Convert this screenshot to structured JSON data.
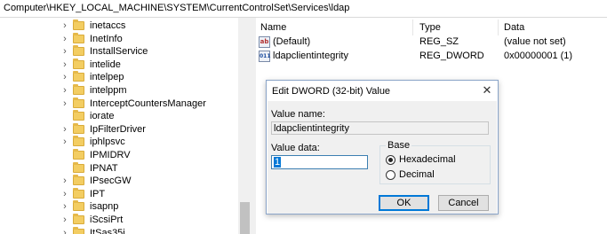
{
  "address": "Computer\\HKEY_LOCAL_MACHINE\\SYSTEM\\CurrentControlSet\\Services\\ldap",
  "tree": [
    {
      "label": "inetaccs",
      "expandable": true
    },
    {
      "label": "InetInfo",
      "expandable": true
    },
    {
      "label": "InstallService",
      "expandable": true
    },
    {
      "label": "intelide",
      "expandable": true
    },
    {
      "label": "intelpep",
      "expandable": true
    },
    {
      "label": "intelppm",
      "expandable": true
    },
    {
      "label": "InterceptCountersManager",
      "expandable": true
    },
    {
      "label": "iorate",
      "expandable": false
    },
    {
      "label": "IpFilterDriver",
      "expandable": true
    },
    {
      "label": "iphlpsvc",
      "expandable": true
    },
    {
      "label": "IPMIDRV",
      "expandable": false
    },
    {
      "label": "IPNAT",
      "expandable": false
    },
    {
      "label": "IPsecGW",
      "expandable": true
    },
    {
      "label": "IPT",
      "expandable": true
    },
    {
      "label": "isapnp",
      "expandable": true
    },
    {
      "label": "iScsiPrt",
      "expandable": true
    },
    {
      "label": "ItSas35i",
      "expandable": true
    }
  ],
  "columns": {
    "name": "Name",
    "type": "Type",
    "data": "Data"
  },
  "values": [
    {
      "icon": "string-value-icon",
      "glyph": "ab",
      "name": "(Default)",
      "type": "REG_SZ",
      "data": "(value not set)"
    },
    {
      "icon": "dword-value-icon",
      "glyph": "011",
      "name": "ldapclientintegrity",
      "type": "REG_DWORD",
      "data": "0x00000001 (1)"
    }
  ],
  "dialog": {
    "title": "Edit DWORD (32-bit) Value",
    "close": "✕",
    "value_name_label": "Value name:",
    "value_name": "ldapclientintegrity",
    "value_data_label": "Value data:",
    "value_data": "1",
    "base_label": "Base",
    "hex_label": "Hexadecimal",
    "dec_label": "Decimal",
    "selected_base": "Hexadecimal",
    "ok": "OK",
    "cancel": "Cancel"
  }
}
